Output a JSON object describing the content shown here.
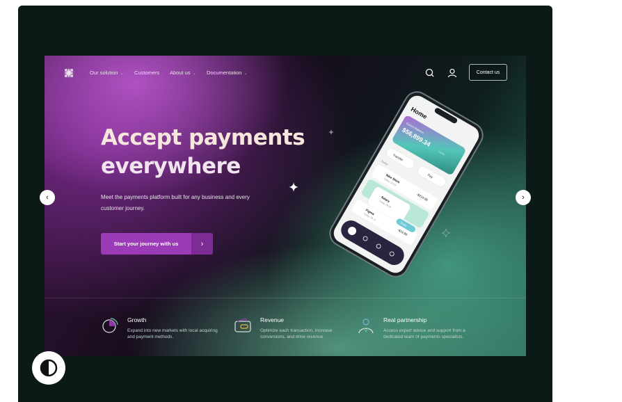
{
  "nav": {
    "items": [
      {
        "label": "Our solution",
        "has_dropdown": true
      },
      {
        "label": "Customers",
        "has_dropdown": false
      },
      {
        "label": "About us",
        "has_dropdown": true
      },
      {
        "label": "Documentation",
        "has_dropdown": true
      }
    ],
    "contact_label": "Contact us",
    "icons": [
      "logo-icon",
      "search-icon",
      "user-icon"
    ]
  },
  "hero": {
    "headline_line1": "Accept payments",
    "headline_line2": "everywhere",
    "subtitle": "Meet the payments platform built for any business and every customer journey.",
    "cta_label": "Start your journey with us",
    "cta_arrow": "›"
  },
  "phone": {
    "screen_title": "Home",
    "card_label": "Current Balance",
    "card_amount": "$56,899.34",
    "card_badge": "+4.4%",
    "actions": [
      "Transfer",
      "Pay"
    ],
    "section_label": "Today",
    "transactions": [
      {
        "name": "Nike Store",
        "sub": "Today, 10:34",
        "amount": "-$214.99"
      },
      {
        "name": "Salary",
        "sub": "Today, 09:00",
        "amount": ""
      },
      {
        "name": "Figma",
        "sub": "Today, 08:12",
        "amount": "-$19.99"
      }
    ],
    "badge": "Salary"
  },
  "features": [
    {
      "title": "Growth",
      "desc": "Expand into new markets with local acquiring and payment methods.",
      "icon": "pie-chart-icon"
    },
    {
      "title": "Revenue",
      "desc": "Optimize each transaction, increase conversions, and drive revenue.",
      "icon": "wallet-icon"
    },
    {
      "title": "Real partnership",
      "desc": "Access expert advice and support from a dedicated team of payments specialists.",
      "icon": "person-icon"
    }
  ],
  "carousel": {
    "prev": "‹",
    "next": "›"
  },
  "colors": {
    "frame": "#0b1a17",
    "accent": "#9b3bb5",
    "teal": "#5fb79c"
  }
}
